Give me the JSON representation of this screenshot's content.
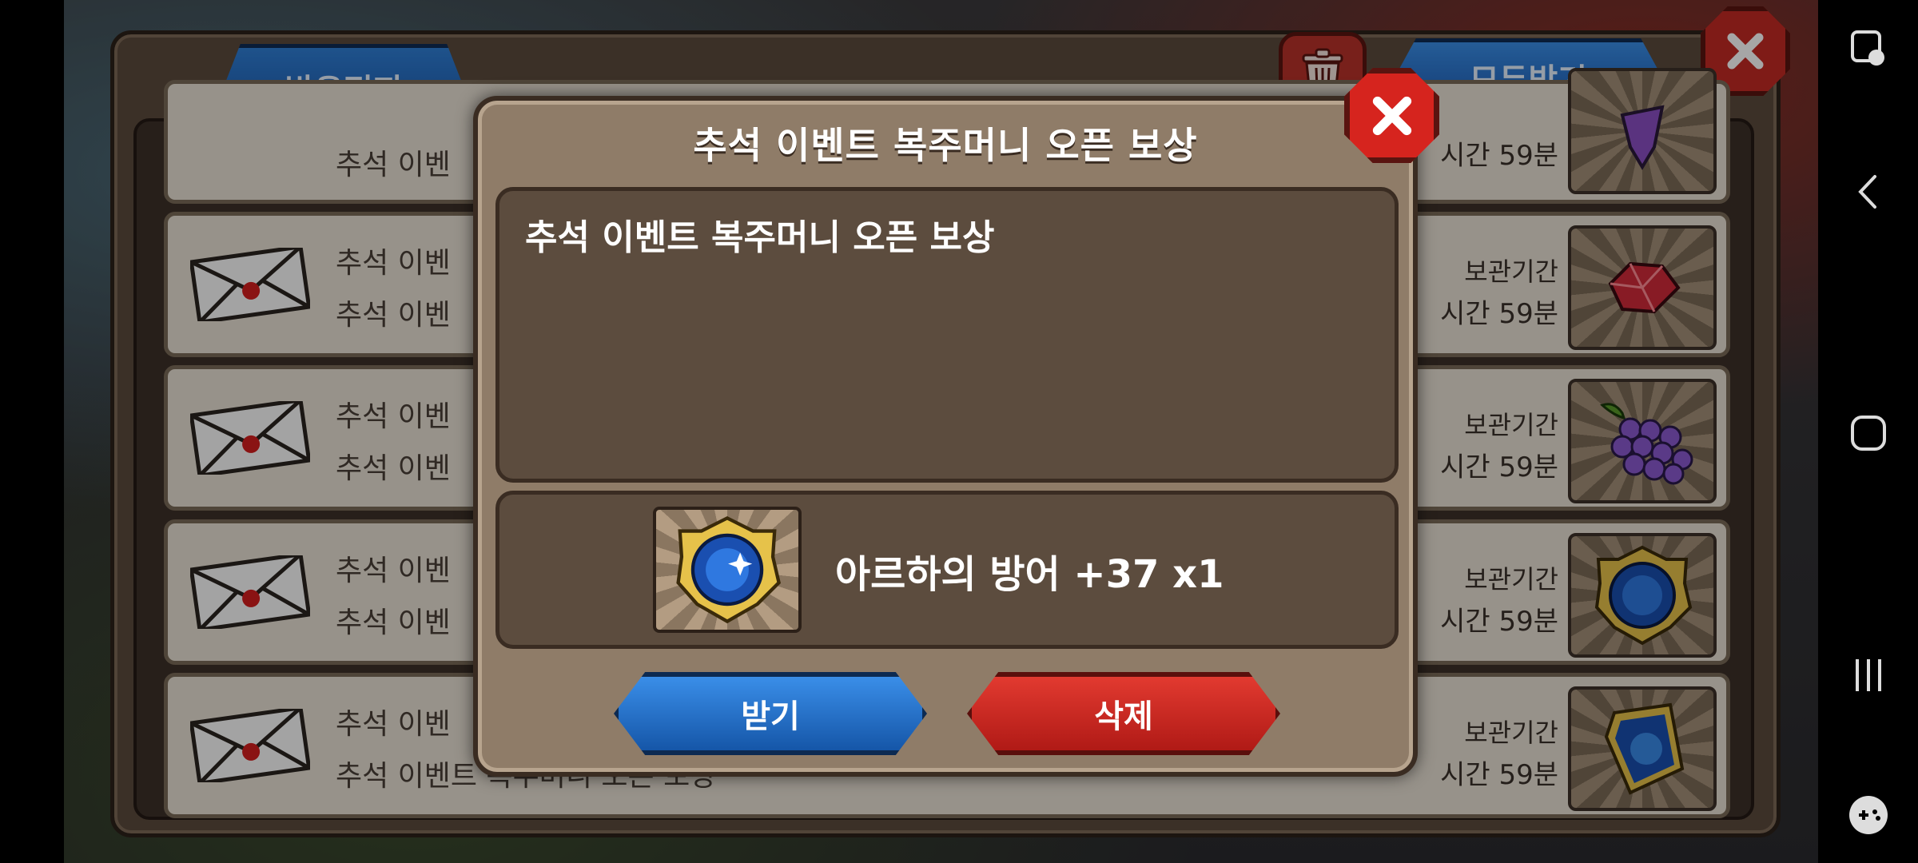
{
  "mailbox": {
    "tab_label": "받은편지",
    "receive_all_label": "모두받기",
    "rows": [
      {
        "line1": "추석 이벤",
        "line2": "",
        "expiry_label": "",
        "expiry_time": "시간 59분",
        "item_icon": "purple-item-icon"
      },
      {
        "line1": "추석 이벤",
        "line2": "추석 이벤",
        "expiry_label": "보관기간",
        "expiry_time": "시간 59분",
        "item_icon": "red-gem-icon"
      },
      {
        "line1": "추석 이벤",
        "line2": "추석 이벤",
        "expiry_label": "보관기간",
        "expiry_time": "시간 59분",
        "item_icon": "grape-icon"
      },
      {
        "line1": "추석 이벤",
        "line2": "추석 이벤",
        "expiry_label": "보관기간",
        "expiry_time": "시간 59분",
        "item_icon": "blue-medal-icon"
      },
      {
        "line1": "추석 이벤",
        "line2": "추석 이벤트 복주머니 오픈 보상",
        "expiry_label": "보관기간",
        "expiry_time": "시간 59분",
        "item_icon": "blue-card-icon"
      }
    ]
  },
  "dialog": {
    "title": "추석 이벤트 복주머니 오픈 보상",
    "message": "추석 이벤트 복주머니 오픈 보상",
    "reward_text": "아르하의 방어 +37 x1",
    "reward_icon": "blue-medal-icon",
    "accept_label": "받기",
    "delete_label": "삭제"
  },
  "colors": {
    "accept": "#1e6cc8",
    "delete": "#d0221c",
    "panel": "#8f7c68"
  }
}
